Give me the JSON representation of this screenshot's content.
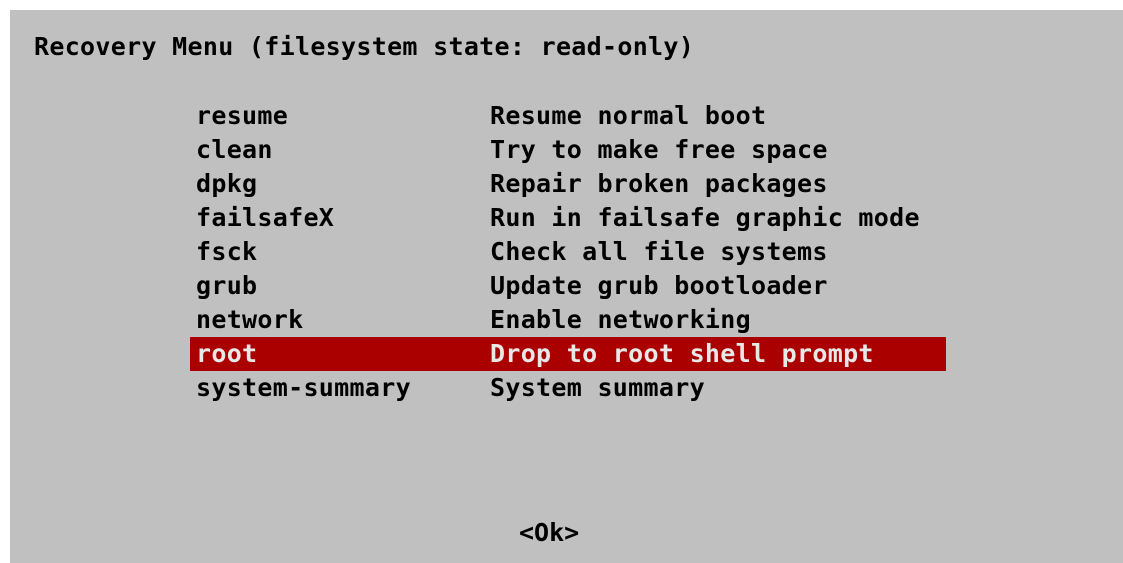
{
  "title": "Recovery Menu (filesystem state: read-only)",
  "colors": {
    "background": "#c0c0c0",
    "text": "#000000",
    "selection_background": "#aa0000",
    "selection_text": "#e8e8e8"
  },
  "menu": {
    "selected_index": 7,
    "items": [
      {
        "command": "resume",
        "description": "Resume normal boot"
      },
      {
        "command": "clean",
        "description": "Try to make free space"
      },
      {
        "command": "dpkg",
        "description": "Repair broken packages"
      },
      {
        "command": "failsafeX",
        "description": "Run in failsafe graphic mode"
      },
      {
        "command": "fsck",
        "description": "Check all file systems"
      },
      {
        "command": "grub",
        "description": "Update grub bootloader"
      },
      {
        "command": "network",
        "description": "Enable networking"
      },
      {
        "command": "root",
        "description": "Drop to root shell prompt"
      },
      {
        "command": "system-summary",
        "description": "System summary"
      }
    ]
  },
  "ok_label": "<Ok>"
}
